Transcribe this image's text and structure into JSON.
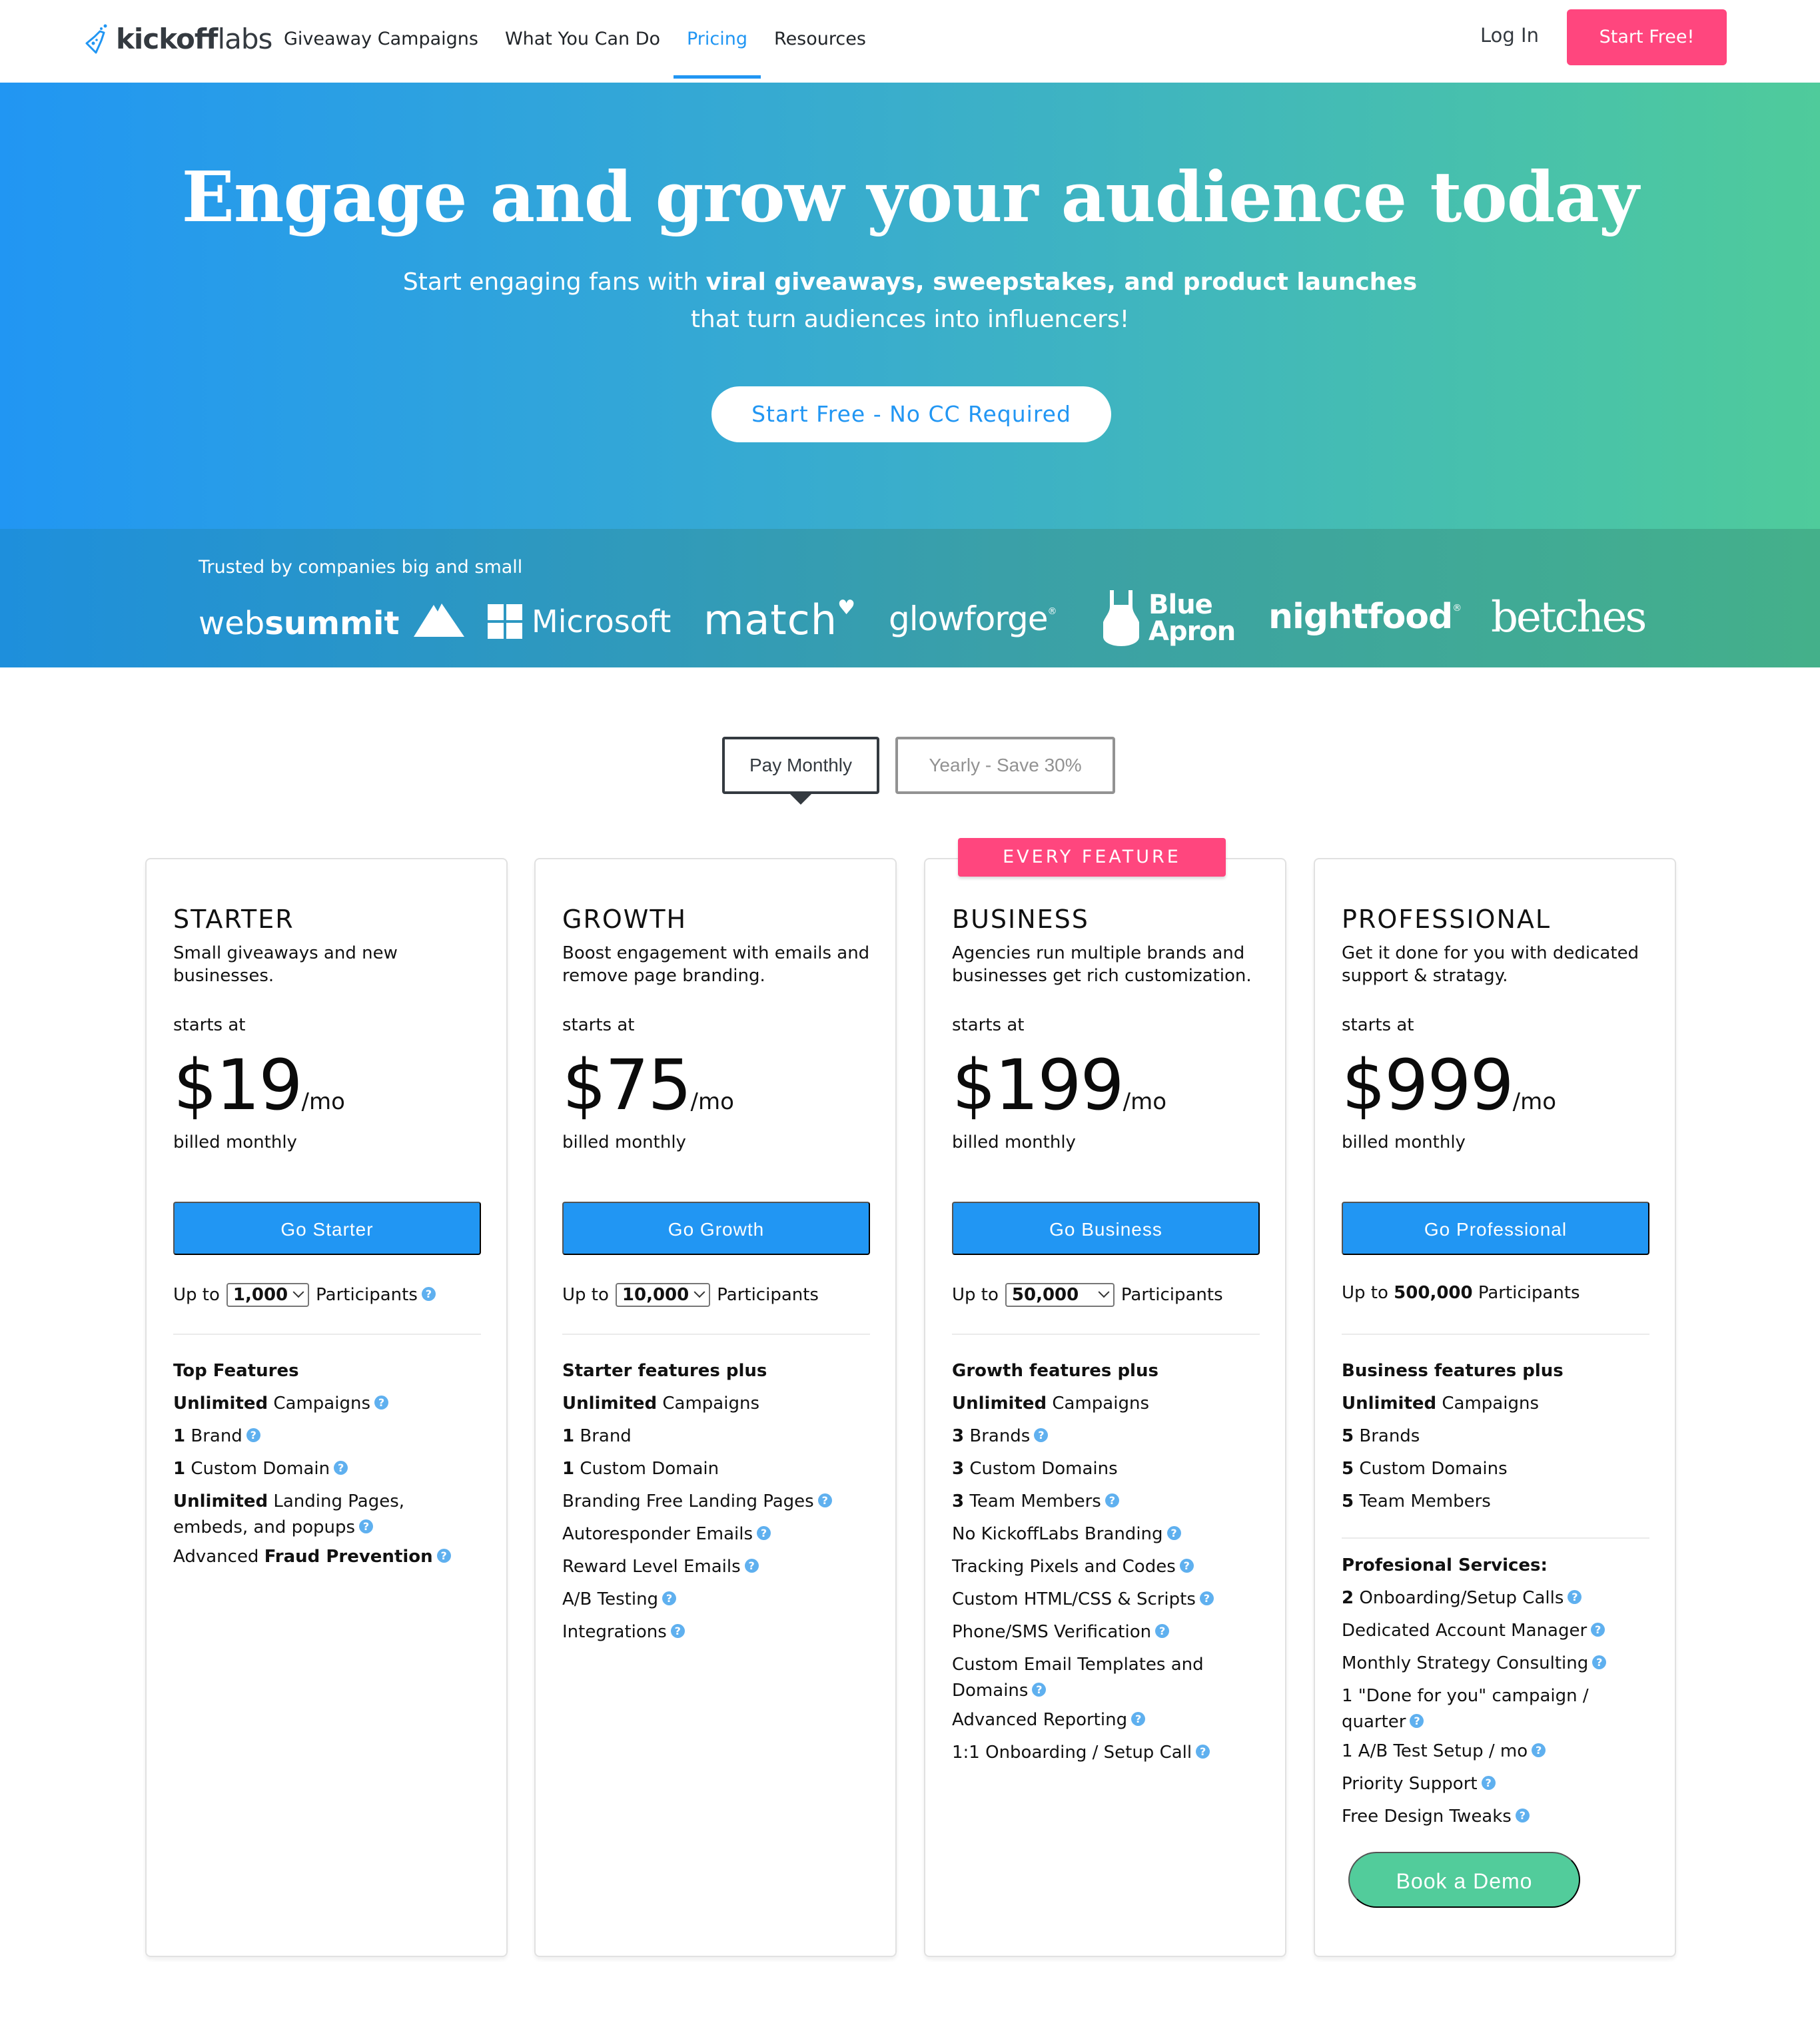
{
  "nav": {
    "logo": {
      "bold": "kickoff",
      "light": "labs"
    },
    "links": [
      {
        "label": "Giveaway Campaigns",
        "active": false
      },
      {
        "label": "What You Can Do",
        "active": false
      },
      {
        "label": "Pricing",
        "active": true
      },
      {
        "label": "Resources",
        "active": false
      }
    ],
    "login": "Log In",
    "cta": "Start Free!"
  },
  "hero": {
    "title": "Engage and grow your audience today",
    "subtitle_pre": "Start engaging fans with ",
    "subtitle_bold": "viral giveaways, sweepstakes, and product launches",
    "subtitle_post": " that turn audiences into influencers!",
    "cta": "Start Free - No CC Required"
  },
  "trust": {
    "label": "Trusted by companies big and small",
    "brands": {
      "websummit_light": "web",
      "websummit_bold": "summit",
      "microsoft": "Microsoft",
      "match": "match",
      "glowforge": "glowforge",
      "blue_apron_1": "Blue",
      "blue_apron_2": "Apron",
      "nightfood": "nightfood",
      "betches": "betches"
    }
  },
  "billing": {
    "monthly": "Pay Monthly",
    "yearly": "Yearly - Save 30%",
    "selected": "monthly"
  },
  "colors": {
    "accent": "#2196f3",
    "pink": "#ff467e",
    "green": "#52cc9b",
    "help_icon": "#5fb0ef"
  },
  "plans": [
    {
      "name": "STARTER",
      "desc": "Small giveaways and new businesses.",
      "starts": "starts at",
      "price": "$19",
      "per": "/mo",
      "billed": "billed monthly",
      "button": "Go Starter",
      "participants_pre": "Up to",
      "participants_value": "1,000",
      "participants_post": "Participants",
      "features": [
        {
          "bold": "Top Features",
          "text": "",
          "help": false,
          "head": true
        },
        {
          "bold": "Unlimited",
          "text": " Campaigns",
          "help": true
        },
        {
          "bold": "1",
          "text": " Brand",
          "help": true
        },
        {
          "bold": "1",
          "text": " Custom Domain",
          "help": true
        },
        {
          "bold": "Unlimited",
          "text": " Landing Pages, embeds, and popups",
          "help": true
        },
        {
          "pre": "Advanced ",
          "bold": "Fraud Prevention",
          "text": "",
          "help": true
        }
      ]
    },
    {
      "name": "GROWTH",
      "desc": "Boost engagement with emails and remove page branding.",
      "starts": "starts at",
      "price": "$75",
      "per": "/mo",
      "billed": "billed monthly",
      "button": "Go Growth",
      "participants_pre": "Up to",
      "participants_value": "10,000",
      "participants_post": "Participants",
      "features": [
        {
          "bold": "Starter features plus",
          "text": "",
          "help": false,
          "head": true
        },
        {
          "bold": "Unlimited",
          "text": " Campaigns",
          "help": false
        },
        {
          "bold": "1",
          "text": " Brand",
          "help": false
        },
        {
          "bold": "1",
          "text": " Custom Domain",
          "help": false
        },
        {
          "bold": "",
          "text": "Branding Free Landing Pages",
          "help": true
        },
        {
          "bold": "",
          "text": "Autoresponder Emails",
          "help": true
        },
        {
          "bold": "",
          "text": "Reward Level Emails",
          "help": true
        },
        {
          "bold": "",
          "text": "A/B Testing",
          "help": true
        },
        {
          "bold": "",
          "text": "Integrations",
          "help": true
        }
      ]
    },
    {
      "badge": "EVERY FEATURE",
      "name": "BUSINESS",
      "desc": "Agencies run multiple brands and businesses get rich customization.",
      "starts": "starts at",
      "price": "$199",
      "per": "/mo",
      "billed": "billed monthly",
      "button": "Go Business",
      "participants_pre": "Up to",
      "participants_value": "50,000",
      "participants_post": "Participants",
      "features": [
        {
          "bold": "Growth features plus",
          "text": "",
          "help": false,
          "head": true
        },
        {
          "bold": "Unlimited",
          "text": " Campaigns",
          "help": false
        },
        {
          "bold": "3",
          "text": " Brands",
          "help": true
        },
        {
          "bold": "3",
          "text": " Custom Domains",
          "help": false
        },
        {
          "bold": "3",
          "text": " Team Members",
          "help": true
        },
        {
          "bold": "",
          "text": "No KickoffLabs Branding",
          "help": true
        },
        {
          "bold": "",
          "text": "Tracking Pixels and Codes",
          "help": true
        },
        {
          "bold": "",
          "text": "Custom HTML/CSS & Scripts",
          "help": true
        },
        {
          "bold": "",
          "text": "Phone/SMS Verification",
          "help": true
        },
        {
          "bold": "",
          "text": "Custom Email Templates and Domains",
          "help": true
        },
        {
          "bold": "",
          "text": "Advanced Reporting",
          "help": true
        },
        {
          "bold": "",
          "text": "1:1 Onboarding / Setup Call",
          "help": true
        }
      ]
    },
    {
      "name": "PROFESSIONAL",
      "desc": "Get it done for you with dedicated support & stratagy.",
      "starts": "starts at",
      "price": "$999",
      "per": "/mo",
      "billed": "billed monthly",
      "button": "Go Professional",
      "participants_pre": "Up to",
      "participants_value": "500,000",
      "participants_post": "Participants",
      "features": [
        {
          "bold": "Business features plus",
          "text": "",
          "help": false,
          "head": true
        },
        {
          "bold": "Unlimited",
          "text": " Campaigns",
          "help": false
        },
        {
          "bold": "5",
          "text": " Brands",
          "help": false
        },
        {
          "bold": "5",
          "text": " Custom Domains",
          "help": false
        },
        {
          "bold": "5",
          "text": " Team Members",
          "help": false
        }
      ],
      "services_title": "Profesional Services:",
      "services": [
        {
          "bold": "2",
          "text": " Onboarding/Setup Calls",
          "help": true
        },
        {
          "bold": "",
          "text": "Dedicated Account Manager",
          "help": true
        },
        {
          "bold": "",
          "text": "Monthly Strategy Consulting",
          "help": true
        },
        {
          "bold": "",
          "text": "1 \"Done for you\" campaign / quarter",
          "help": true
        },
        {
          "bold": "",
          "text": "1 A/B Test Setup / mo",
          "help": true
        },
        {
          "bold": "",
          "text": "Priority Support",
          "help": true
        },
        {
          "bold": "",
          "text": "Free Design Tweaks",
          "help": true
        }
      ],
      "demo_button": "Book a Demo"
    }
  ]
}
